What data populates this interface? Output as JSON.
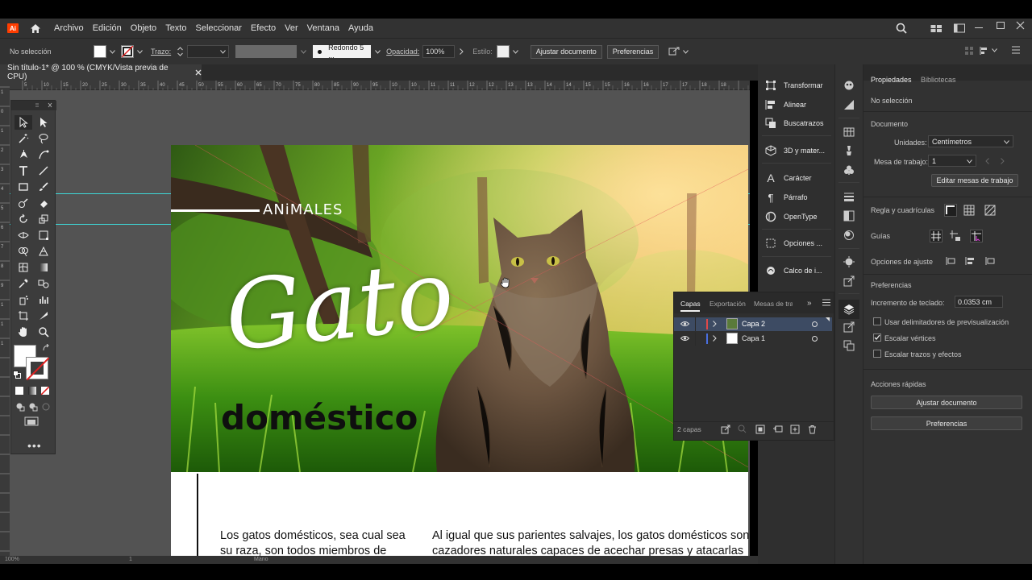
{
  "app": {
    "logo": "Ai",
    "menu": [
      "Archivo",
      "Edición",
      "Objeto",
      "Texto",
      "Seleccionar",
      "Efecto",
      "Ver",
      "Ventana",
      "Ayuda"
    ]
  },
  "controlbar": {
    "selection": "No selección",
    "stroke_label": "Trazo:",
    "brush": "Redondo 5 ...",
    "opacity_label": "Opacidad:",
    "opacity_value": "100%",
    "style_label": "Estilo:",
    "fit_document": "Ajustar documento",
    "preferences": "Preferencias"
  },
  "document": {
    "tab_title": "Sin título-1* @ 100 % (CMYK/Vista previa de CPU)",
    "ruler_ticks": [
      "5",
      "10",
      "15",
      "20",
      "25",
      "30",
      "35",
      "40",
      "45",
      "50",
      "55",
      "60",
      "65",
      "70",
      "75",
      "80",
      "85",
      "90",
      "95",
      "10",
      "10",
      "11",
      "11",
      "12",
      "12",
      "13",
      "13",
      "14",
      "14",
      "15",
      "15",
      "16",
      "16",
      "17",
      "17",
      "18",
      "18"
    ],
    "ruler_left_ticks": [
      "1",
      "0",
      "1",
      "2",
      "3",
      "4",
      "5",
      "6",
      "7",
      "8",
      "9",
      "1",
      "1",
      "1"
    ]
  },
  "artwork": {
    "kicker": "ANiMALES",
    "title_script": "Gato",
    "subtitle": "doméstico",
    "body_col1": "Los gatos domésticos, sea cual sea su raza, son todos miembros de",
    "body_col2": "Al igual que sus parientes salvajes, los gatos domésticos son cazadores naturales capaces de acechar presas y atacarlas co"
  },
  "dock": {
    "entries": [
      "Transformar",
      "Alinear",
      "Buscatrazos",
      "3D y mater...",
      "Carácter",
      "Párrafo",
      "OpenType",
      "Opciones ...",
      "Calco de i..."
    ]
  },
  "layers": {
    "tabs": [
      "Capas",
      "Exportación",
      "Mesas de tra"
    ],
    "rows": [
      {
        "name": "Capa 2",
        "color": "#e04848"
      },
      {
        "name": "Capa 1",
        "color": "#4a6fe0"
      }
    ],
    "count": "2 capas"
  },
  "properties": {
    "tabs": [
      "Propiedades",
      "Bibliotecas"
    ],
    "no_selection": "No selección",
    "document": "Documento",
    "units_label": "Unidades:",
    "units_value": "Centímetros",
    "artboard_label": "Mesa de trabajo:",
    "artboard_value": "1",
    "edit_artboards": "Editar mesas de trabajo",
    "rulers_grids": "Regla y cuadrículas",
    "guides": "Guías",
    "snap_options": "Opciones de ajuste",
    "preferences": "Preferencias",
    "keyboard_increment_label": "Incremento de teclado:",
    "keyboard_increment_value": "0.0353 cm",
    "preview_bounds": "Usar delimitadores de previsualización",
    "scale_corners": "Escalar vértices",
    "scale_strokes": "Escalar trazos y efectos",
    "quick_actions": "Acciones rápidas",
    "fit_document": "Ajustar documento",
    "preferences_btn": "Preferencias"
  },
  "statusbar": {
    "zoom": "100%",
    "page": "1",
    "tool": "Mano"
  },
  "colors": {
    "accent": "#2680eb",
    "brand": "#ff3d00",
    "guide": "#3ed6d6",
    "panel": "#323232",
    "canvas": "#535353"
  }
}
